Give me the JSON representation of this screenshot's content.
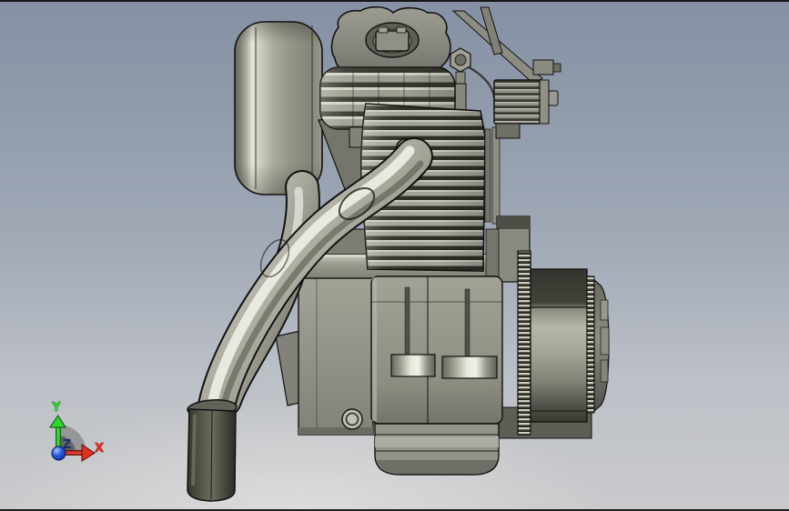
{
  "viewport": {
    "type": "cad-3d-viewport",
    "background": {
      "top": "#8591a4",
      "upper": "#919bab",
      "middle": "#a2aab7",
      "lower": "#bcc0c7",
      "bottom": "#c9cacc"
    },
    "edge_line_color": "#0a0a0a"
  },
  "triad": {
    "x_label": "X",
    "y_label": "Y",
    "z_label": "Z",
    "x_color": "#e03222",
    "y_color": "#2fd42f",
    "z_color": "#16306e",
    "origin_sphere_color": "#1a44c2",
    "arc_color": "#929292"
  },
  "model": {
    "name": "single-cylinder-engine",
    "material": {
      "base_gray": "#9a9a8e",
      "dark_shadow": "#3a3a32",
      "highlight": "#ecece2",
      "edge_lines": "#111111"
    },
    "parts": [
      "muffler-canister",
      "valve-cover",
      "oil-filler-plug",
      "rocker-box-fins",
      "cylinder-cooling-fins",
      "exhaust-flange",
      "exhaust-header-pipe",
      "exhaust-outlet-pipe",
      "exhaust-tip",
      "carburetor",
      "carburetor-bracket",
      "throttle-linkage-wires",
      "rocker-nut",
      "pushrod-tubes",
      "engine-mount-bracket",
      "crankcase-front-mount",
      "crankcase",
      "mounting-lugs",
      "oil-sump",
      "drain-bolt",
      "starter-gear-ring",
      "starter-drum",
      "rear-end-cap"
    ]
  }
}
